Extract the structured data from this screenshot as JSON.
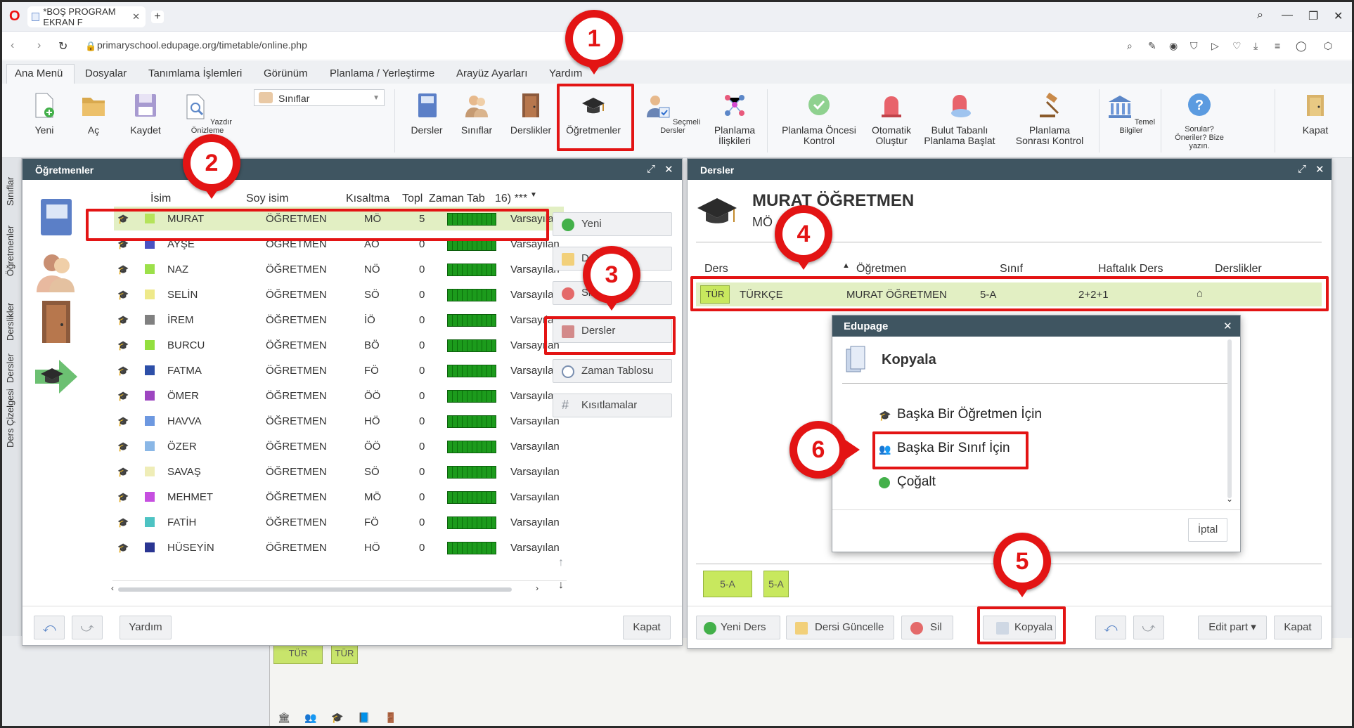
{
  "browser": {
    "tab_title": "*BOŞ PROGRAM EKRAN F",
    "url": "primaryschool.edupage.org/timetable/online.php"
  },
  "menu": {
    "tabs": [
      "Ana Menü",
      "Dosyalar",
      "Tanımlama İşlemleri",
      "Görünüm",
      "Planlama / Yerleştirme",
      "Arayüz Ayarları",
      "Yardım"
    ]
  },
  "ribbon": {
    "yeni": "Yeni",
    "ac": "Aç",
    "kaydet": "Kaydet",
    "yazdir": "Yazdır Önizleme",
    "select": "Sınıflar",
    "dersler": "Dersler",
    "siniflar": "Sınıflar",
    "derslikler": "Derslikler",
    "ogretmenler": "Öğretmenler",
    "secmeli": "Seçmeli Dersler",
    "planlama_iliskileri_1": "Planlama",
    "planlama_iliskileri_2": "İlişkileri",
    "once_1": "Planlama Öncesi",
    "once_2": "Kontrol",
    "oto_1": "Otomatik",
    "oto_2": "Oluştur",
    "bulut_1": "Bulut Tabanlı",
    "bulut_2": "Planlama Başlat",
    "sonra_1": "Planlama",
    "sonra_2": "Sonrası Kontrol",
    "temel": "Temel Bilgiler",
    "sorular_1": "Sorular?",
    "sorular_2": "Öneriler? Bize",
    "sorular_3": "yazın.",
    "kapat": "Kapat"
  },
  "sidevert": [
    "Sınıflar",
    "Öğretmenler",
    "Derslikler",
    "Dersler",
    "Ders Çizelgesi"
  ],
  "teachers_panel": {
    "title": "Öğretmenler",
    "headers": [
      "İsim",
      "Soy isim",
      "Kısaltma",
      "Topl",
      "Zaman Tab",
      "16) ***"
    ],
    "rows": [
      {
        "name": "MURAT",
        "surname": "ÖĞRETMEN",
        "abbr": "MÖ",
        "total": "5",
        "default": "Varsayılan",
        "color": "#b5e35a"
      },
      {
        "name": "AYŞE",
        "surname": "ÖĞRETMEN",
        "abbr": "AÖ",
        "total": "0",
        "default": "Varsayılan",
        "color": "#4a52c2"
      },
      {
        "name": "NAZ",
        "surname": "ÖĞRETMEN",
        "abbr": "NÖ",
        "total": "0",
        "default": "Varsayılan",
        "color": "#9ce04a"
      },
      {
        "name": "SELİN",
        "surname": "ÖĞRETMEN",
        "abbr": "SÖ",
        "total": "0",
        "default": "Varsayılan",
        "color": "#eee98a"
      },
      {
        "name": "İREM",
        "surname": "ÖĞRETMEN",
        "abbr": "İÖ",
        "total": "0",
        "default": "Varsayılan",
        "color": "#808080"
      },
      {
        "name": "BURCU",
        "surname": "ÖĞRETMEN",
        "abbr": "BÖ",
        "total": "0",
        "default": "Varsayılan",
        "color": "#93df3f"
      },
      {
        "name": "FATMA",
        "surname": "ÖĞRETMEN",
        "abbr": "FÖ",
        "total": "0",
        "default": "Varsayılan",
        "color": "#2d4fa8"
      },
      {
        "name": "ÖMER",
        "surname": "ÖĞRETMEN",
        "abbr": "ÖÖ",
        "total": "0",
        "default": "Varsayılan",
        "color": "#9d45c0"
      },
      {
        "name": "HAVVA",
        "surname": "ÖĞRETMEN",
        "abbr": "HÖ",
        "total": "0",
        "default": "Varsayılan",
        "color": "#6d98e0"
      },
      {
        "name": "ÖZER",
        "surname": "ÖĞRETMEN",
        "abbr": "ÖÖ",
        "total": "0",
        "default": "Varsayılan",
        "color": "#8ab7e6"
      },
      {
        "name": "SAVAŞ",
        "surname": "ÖĞRETMEN",
        "abbr": "SÖ",
        "total": "0",
        "default": "Varsayılan",
        "color": "#efedb7"
      },
      {
        "name": "MEHMET",
        "surname": "ÖĞRETMEN",
        "abbr": "MÖ",
        "total": "0",
        "default": "Varsayılan",
        "color": "#c64fe0"
      },
      {
        "name": "FATİH",
        "surname": "ÖĞRETMEN",
        "abbr": "FÖ",
        "total": "0",
        "default": "Varsayılan",
        "color": "#4dc3c3"
      },
      {
        "name": "HÜSEYİN",
        "surname": "ÖĞRETMEN",
        "abbr": "HÖ",
        "total": "0",
        "default": "Varsayılan",
        "color": "#2a3592"
      }
    ],
    "side_buttons": {
      "yeni": "Yeni",
      "duzenle": "D",
      "sil": "Sil",
      "dersler": "Dersler",
      "zaman": "Zaman Tablosu",
      "kisit": "Kısıtlamalar"
    },
    "footer": {
      "yardim": "Yardım",
      "kapat": "Kapat"
    }
  },
  "lessons_panel": {
    "title": "Dersler",
    "teacher_name": "MURAT ÖĞRETMEN",
    "teacher_abbr": "MÖ",
    "headers": [
      "Ders",
      "Öğretmen",
      "Sınıf",
      "Haftalık Ders",
      "Derslikler"
    ],
    "row": {
      "code": "TÜR",
      "subject": "TÜRKÇE",
      "teacher": "MURAT ÖĞRETMEN",
      "class": "5-A",
      "weekly": "2+2+1"
    },
    "class_cells": [
      "5-A",
      "5-A"
    ],
    "footer": {
      "yeni": "Yeni Ders",
      "guncelle": "Dersi Güncelle",
      "sil": "Sil",
      "kopyala": "Kopyala",
      "editpart": "Edit part ▾",
      "kapat": "Kapat"
    }
  },
  "dialog": {
    "title": "Edupage",
    "heading": "Kopyala",
    "opt1": "Başka Bir Öğretmen İçin",
    "opt2": "Başka Bir Sınıf İçin",
    "opt3": "Çoğalt",
    "cancel": "İptal"
  },
  "background": {
    "cells": [
      "TÜR",
      "TÜR"
    ]
  },
  "annotations": {
    "n1": "1",
    "n2": "2",
    "n3": "3",
    "n4": "4",
    "n5": "5",
    "n6": "6"
  }
}
